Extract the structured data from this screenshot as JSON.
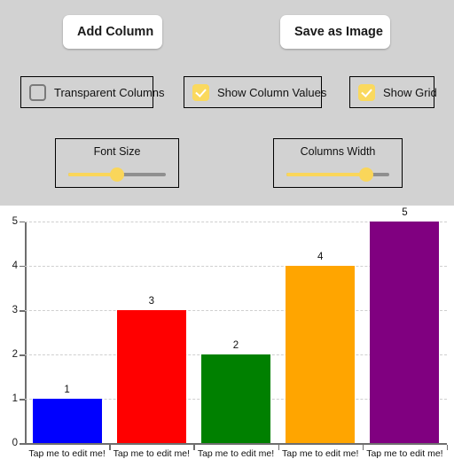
{
  "toolbar": {
    "background": "#d2d2d2",
    "buttons": [
      {
        "id": "add-column",
        "label": "Add Column"
      },
      {
        "id": "save-image",
        "label": "Save as Image"
      }
    ],
    "checkboxes": [
      {
        "id": "transparent-columns",
        "label": "Transparent Columns",
        "checked": false
      },
      {
        "id": "show-column-values",
        "label": "Show Column Values",
        "checked": true
      },
      {
        "id": "show-grid",
        "label": "Show Grid",
        "checked": true
      }
    ],
    "sliders": [
      {
        "id": "font-size",
        "label": "Font Size",
        "percent": 50
      },
      {
        "id": "columns-width",
        "label": "Columns Width",
        "percent": 78
      }
    ],
    "accent_color": "#fad65a",
    "track_color": "#8f8f8f"
  },
  "chart_data": {
    "type": "bar",
    "title": "",
    "xlabel": "",
    "ylabel": "",
    "categories": [
      "Tap me to edit me!",
      "Tap me to edit me!",
      "Tap me to edit me!",
      "Tap me to edit me!",
      "Tap me to edit me!"
    ],
    "values": [
      1,
      3,
      2,
      4,
      5
    ],
    "value_labels": [
      "1",
      "3",
      "2",
      "4",
      "5"
    ],
    "colors": [
      "#0000ff",
      "#ff0000",
      "#008000",
      "#ffa500",
      "#800080"
    ],
    "ylim": [
      0,
      5
    ],
    "yticks": [
      0,
      1,
      2,
      3,
      4,
      5
    ],
    "ytick_labels": [
      "0",
      "1",
      "2",
      "3",
      "4",
      "5"
    ],
    "grid": true,
    "grid_color": "#cfcfcf",
    "axis_color": "#6e6e6e",
    "legend": null,
    "show_values": true
  }
}
